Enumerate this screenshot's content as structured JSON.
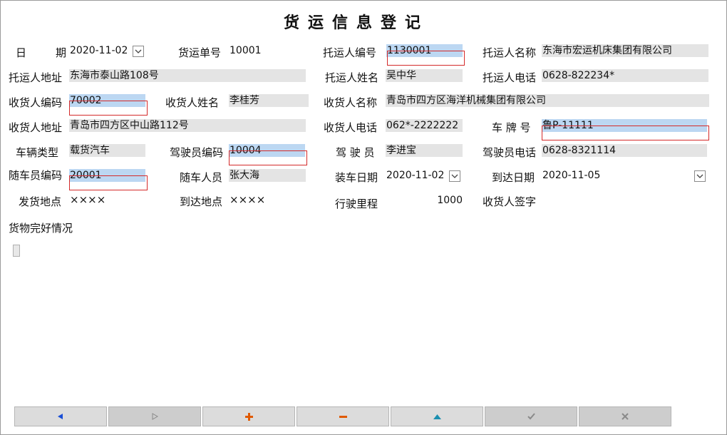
{
  "title": "货运信息登记",
  "labels": {
    "date_1": "日",
    "date_2": "期",
    "waybill_no": "货运单号",
    "shipper_code": "托运人编号",
    "shipper_name": "托运人名称",
    "shipper_address": "托运人地址",
    "shipper_person": "托运人姓名",
    "shipper_phone": "托运人电话",
    "consignee_code": "收货人编码",
    "consignee_person": "收货人姓名",
    "consignee_name": "收货人名称",
    "consignee_address": "收货人地址",
    "consignee_phone": "收货人电话",
    "plate": "车 牌 号",
    "vehicle_type": "车辆类型",
    "driver_code": "驾驶员编码",
    "driver": "驾 驶 员",
    "driver_phone": "驾驶员电话",
    "escort_code": "随车员编码",
    "escort_person": "随车人员",
    "load_date": "装车日期",
    "arrive_date": "到达日期",
    "origin": "发货地点",
    "destination": "到达地点",
    "mileage": "行驶里程",
    "signature": "收货人签字",
    "condition": "货物完好情况"
  },
  "values": {
    "date": "2020-11-02",
    "waybill_no": "10001",
    "shipper_code": "1130001",
    "shipper_name": "东海市宏运机床集团有限公司",
    "shipper_address": "东海市泰山路108号",
    "shipper_person": "吴中华",
    "shipper_phone": "0628-822234*",
    "consignee_code": "70002",
    "consignee_person": "李桂芳",
    "consignee_name": "青岛市四方区海洋机械集团有限公司",
    "consignee_address": "青岛市四方区中山路112号",
    "consignee_phone": "062*-2222222",
    "plate": "鲁P-11111",
    "vehicle_type": "载货汽车",
    "driver_code": "10004",
    "driver": "李进宝",
    "driver_phone": "0628-8321114",
    "escort_code": "20001",
    "escort_person": "张大海",
    "load_date": "2020-11-02",
    "arrive_date": "2020-11-05",
    "origin": "××××",
    "destination": "××××",
    "mileage": "1000",
    "signature": ""
  },
  "condition_checked": false,
  "buttons": [
    {
      "name": "prev-record-button",
      "icon": "triangle-left-icon",
      "color": "#1a4fd6",
      "disabled": false
    },
    {
      "name": "next-record-button",
      "icon": "triangle-right-icon",
      "color": "#8a8a8a",
      "disabled": true
    },
    {
      "name": "add-record-button",
      "icon": "plus-icon",
      "color": "#e05a00",
      "disabled": false
    },
    {
      "name": "delete-record-button",
      "icon": "minus-icon",
      "color": "#e05a00",
      "disabled": false
    },
    {
      "name": "edit-record-button",
      "icon": "triangle-up-icon",
      "color": "#1b8fb0",
      "disabled": false
    },
    {
      "name": "save-record-button",
      "icon": "check-icon",
      "color": "#8a8a8a",
      "disabled": true
    },
    {
      "name": "cancel-record-button",
      "icon": "cross-icon",
      "color": "#8a8a8a",
      "disabled": true
    }
  ],
  "colors": {
    "field_gray": "#e4e4e4",
    "field_selected_blue": "#bcd7f2",
    "validation_red": "#d42a2a"
  }
}
